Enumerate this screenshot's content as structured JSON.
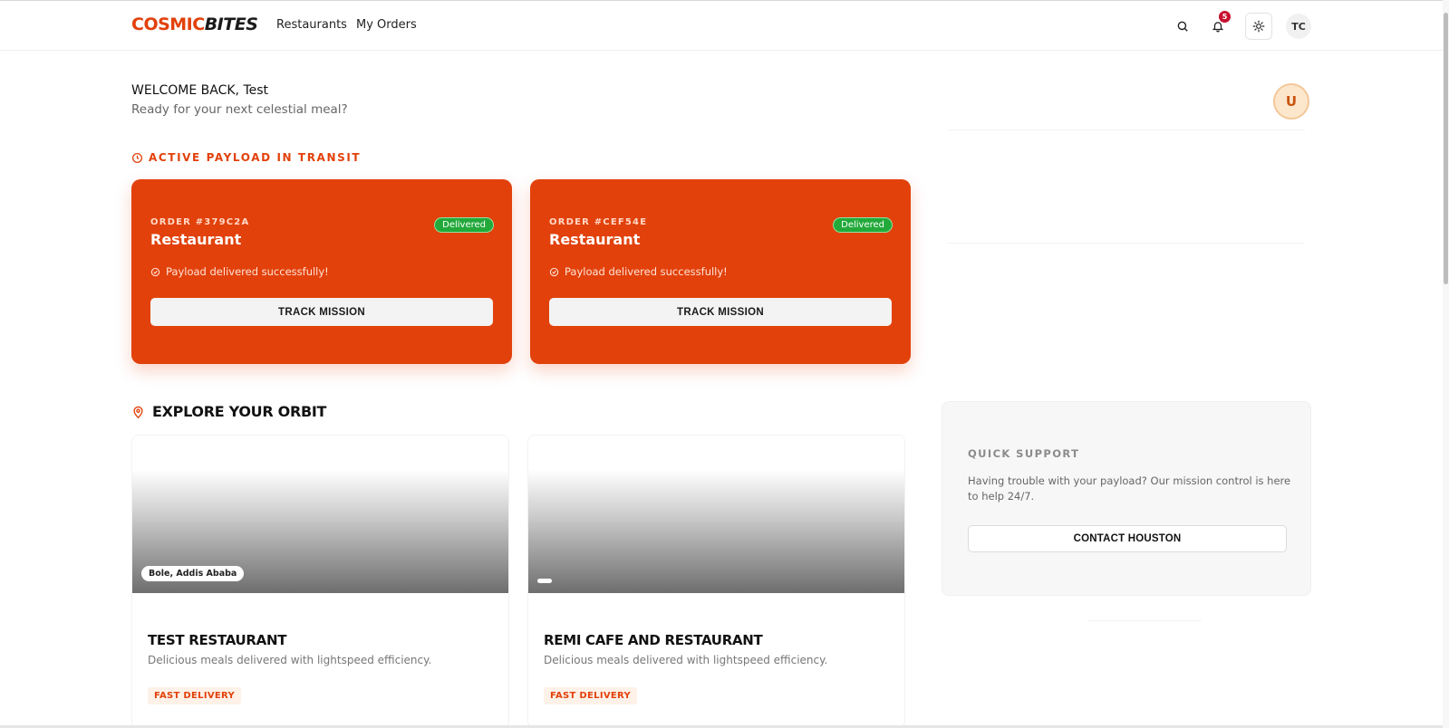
{
  "header": {
    "logo_a": "COSMIC",
    "logo_b": "BITES",
    "nav": [
      "Restaurants",
      "My Orders"
    ],
    "notifications_count": "5",
    "user_initials": "TC"
  },
  "welcome": {
    "title": "WELCOME BACK, Test",
    "subtitle": "Ready for your next celestial meal?",
    "avatar_initial": "U"
  },
  "active_section": {
    "title": "ACTIVE PAYLOAD IN TRANSIT"
  },
  "orders": [
    {
      "id": "ORDER #379C2A",
      "title": "Restaurant",
      "badge": "Delivered",
      "status": "Payload delivered successfully!",
      "button": "TRACK MISSION"
    },
    {
      "id": "ORDER #CEF54E",
      "title": "Restaurant",
      "badge": "Delivered",
      "status": "Payload delivered successfully!",
      "button": "TRACK MISSION"
    }
  ],
  "explore": {
    "title": "EXPLORE YOUR ORBIT"
  },
  "restaurants": [
    {
      "location": "Bole, Addis Ababa",
      "name": "TEST RESTAURANT",
      "description": "Delicious meals delivered with lightspeed efficiency.",
      "tag": "FAST DELIVERY"
    },
    {
      "location": "",
      "name": "REMI CAFE AND RESTAURANT",
      "description": "Delicious meals delivered with lightspeed efficiency.",
      "tag": "FAST DELIVERY"
    }
  ],
  "support": {
    "title": "QUICK SUPPORT",
    "text": "Having trouble with your payload? Our mission control is here to help 24/7.",
    "button": "CONTACT HOUSTON"
  },
  "colors": {
    "accent": "#e2410b",
    "success": "#22a93a",
    "badge": "#c8102e"
  }
}
